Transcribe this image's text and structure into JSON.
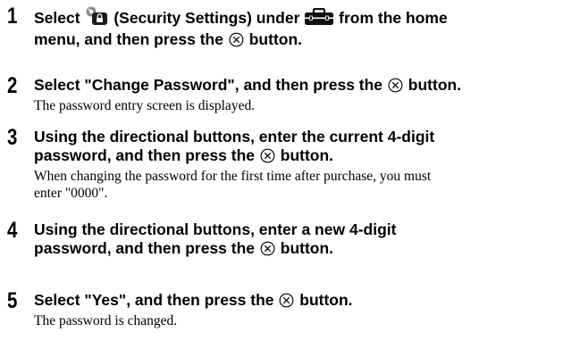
{
  "steps": [
    {
      "number": "1",
      "heading": {
        "t1": "Select",
        "t2": "(Security Settings) under",
        "t3": "from the home",
        "t4": "menu, and then press the",
        "t5": "button."
      }
    },
    {
      "number": "2",
      "heading": {
        "t1": "Select \"Change Password\", and then press the",
        "t2": "button."
      },
      "body": "The password entry screen is displayed."
    },
    {
      "number": "3",
      "heading": {
        "t1": "Using the directional buttons, enter the current 4-digit",
        "t2": "password, and then press the",
        "t3": "button."
      },
      "body_line1": "When changing the password for the first time after purchase, you must",
      "body_line2": "enter \"0000\"."
    },
    {
      "number": "4",
      "heading": {
        "t1": "Using the directional buttons, enter a new 4-digit",
        "t2": "password, and then press the",
        "t3": "button."
      }
    },
    {
      "number": "5",
      "heading": {
        "t1": "Select \"Yes\", and then press the",
        "t2": "button."
      },
      "body": "The password is changed."
    }
  ],
  "icons": {
    "security": "security-settings-icon",
    "toolbox": "toolbox-settings-icon",
    "cross": "cross-button-icon"
  }
}
